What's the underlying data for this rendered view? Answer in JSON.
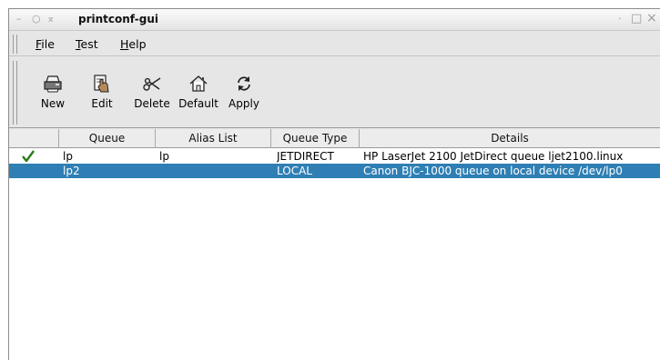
{
  "window": {
    "title": "printconf-gui",
    "controls": {
      "minimize": "–",
      "circle": "○",
      "menu": "⌅",
      "shade": "·",
      "maximize": "□",
      "close": "×"
    }
  },
  "menubar": {
    "items": [
      {
        "first": "F",
        "rest": "ile"
      },
      {
        "first": "T",
        "rest": "est"
      },
      {
        "first": "H",
        "rest": "elp"
      }
    ]
  },
  "toolbar": {
    "new_label": "New",
    "edit_label": "Edit",
    "delete_label": "Delete",
    "default_label": "Default",
    "apply_label": "Apply"
  },
  "table": {
    "columns": [
      "",
      "Queue",
      "Alias List",
      "Queue Type",
      "Details"
    ],
    "rows": [
      {
        "default": true,
        "queue": "lp",
        "alias": "lp",
        "type": "JETDIRECT",
        "details": "HP LaserJet 2100 JetDirect queue ljet2100.linux",
        "selected": false
      },
      {
        "default": false,
        "queue": "lp2",
        "alias": "",
        "type": "LOCAL",
        "details": "Canon BJC-1000 queue on local device /dev/lp0",
        "selected": true
      }
    ]
  },
  "colors": {
    "selection": "#2f7fb4",
    "checkmark": "#2c7a1c"
  },
  "icons": {
    "new": "printer-icon",
    "edit": "edit-hand-icon",
    "delete": "scissors-icon",
    "default": "home-icon",
    "apply": "apply-arrows-icon",
    "default_marker": "checkmark-icon"
  }
}
